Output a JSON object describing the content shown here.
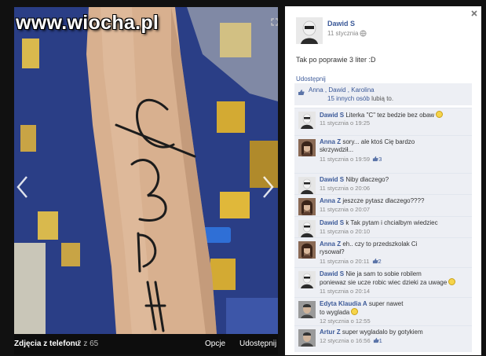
{
  "watermark": "www.wiocha.pl",
  "photo_bar": {
    "album": "Zdjęcia z telefonu",
    "counter": "2 z 65",
    "options": "Opcje",
    "share": "Udostępnij"
  },
  "post": {
    "owner": "Dawid S",
    "date": "11 stycznia",
    "caption": "Tak po poprawie 3 liter :D",
    "share_label": "Udostępnij",
    "likes_line1": "Anna , Dawid , Karolina",
    "likes_line2_link": "15 innych osób",
    "likes_line2_rest": "lubią to."
  },
  "comments": [
    {
      "author": "Dawid S",
      "text": "Literka \"C\" tez bedzie bez obaw",
      "text2": "",
      "emoji": true,
      "time": "11 stycznia o 19:25",
      "likes": ""
    },
    {
      "author": "Anna Z",
      "text": "sory... ale ktoś Cię bardzo",
      "text2": "skrzywdził...",
      "emoji": false,
      "time": "11 stycznia o 19:59",
      "likes": "3"
    },
    {
      "author": "Dawid S",
      "text": "Niby dlaczego?",
      "text2": "",
      "emoji": false,
      "time": "11 stycznia o 20:06",
      "likes": ""
    },
    {
      "author": "Anna Z",
      "text": "jeszcze pytasz dlaczego????",
      "text2": "",
      "emoji": false,
      "time": "11 stycznia o 20:07",
      "likes": ""
    },
    {
      "author": "Dawid S",
      "text": "k Tak pytam i chcialbym wiedziec",
      "text2": "",
      "emoji": false,
      "time": "11 stycznia o 20:10",
      "likes": ""
    },
    {
      "author": "Anna Z",
      "text": "eh.. czy to przedszkolak Ci",
      "text2": "rysował?",
      "emoji": false,
      "time": "11 stycznia o 20:11",
      "likes": "2"
    },
    {
      "author": "Dawid S",
      "text": "Nie ja sam to sobie robilem",
      "text2": "poniewaz sie ucze robic wiec dzieki za uwage",
      "emoji": true,
      "time": "11 stycznia o 20:14",
      "likes": ""
    },
    {
      "author": "Edyta Klaudia A",
      "text": "super nawet",
      "text2": "to wyglada",
      "emoji": true,
      "time": "12 stycznia o 12:55",
      "likes": ""
    },
    {
      "author": "Artur Z",
      "text": "super wygladalo by gotykiem",
      "text2": "",
      "emoji": false,
      "time": "12 stycznia o 16:56",
      "likes": "1"
    }
  ],
  "colors": {
    "link": "#3b5998",
    "panel_bg": "#ffffff",
    "comment_bg": "#edeff4",
    "backdrop": "#111111"
  },
  "icons": {
    "close": "close-icon",
    "thumb": "thumb-up-icon",
    "globe": "globe-icon",
    "prev": "chevron-left-icon",
    "next": "chevron-right-icon"
  }
}
